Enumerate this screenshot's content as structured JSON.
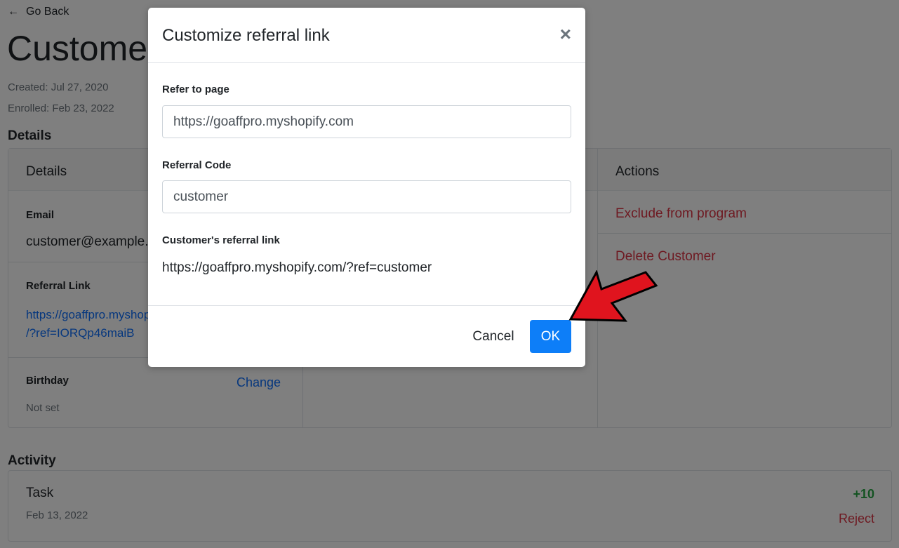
{
  "back": {
    "label": "Go Back"
  },
  "page": {
    "title": "Customer",
    "created": "Created: Jul 27, 2020",
    "enrolled": "Enrolled: Feb 23, 2022"
  },
  "details_section": {
    "title": "Details",
    "column_title": "Details",
    "email_label": "Email",
    "email_value": "customer@example.com",
    "referral_link_label": "Referral Link",
    "referral_link_line1": "https://goaffpro.myshopify.com",
    "referral_link_line2": "/?ref=IORQp46maiB",
    "birthday_label": "Birthday",
    "birthday_change": "Change",
    "birthday_value": "Not set"
  },
  "actions": {
    "title": "Actions",
    "exclude": "Exclude from program",
    "delete": "Delete Customer"
  },
  "activity": {
    "title": "Activity",
    "items": [
      {
        "name": "Task",
        "date": "Feb 13, 2022",
        "points": "+10",
        "reject": "Reject"
      }
    ]
  },
  "modal": {
    "title": "Customize referral link",
    "close_glyph": "×",
    "refer_label": "Refer to page",
    "refer_value": "https://goaffpro.myshopify.com",
    "code_label": "Referral Code",
    "code_value": "customer",
    "link_label": "Customer's referral link",
    "link_value": "https://goaffpro.myshopify.com/?ref=customer",
    "cancel": "Cancel",
    "ok": "OK"
  },
  "colors": {
    "primary": "#0d7ef8",
    "danger": "#dc3545",
    "success": "#28a745",
    "annotation_arrow": "#e0141e"
  },
  "icons": [
    "arrow-left-icon",
    "close-icon",
    "red-pointer-arrow"
  ]
}
